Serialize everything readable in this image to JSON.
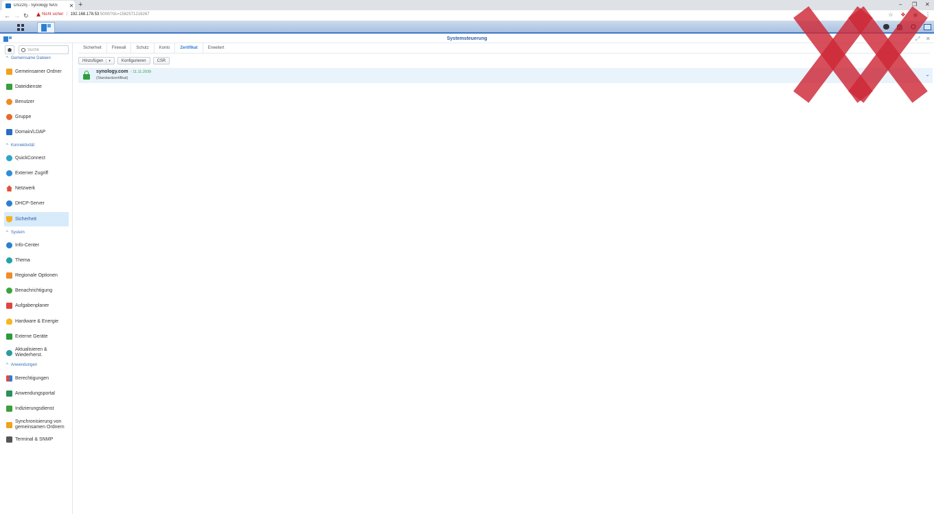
{
  "browser": {
    "tab_title": "DS220j - Synology NAS",
    "tab_close": "✕",
    "new_tab": "+",
    "security_warning": "Nicht sicher",
    "url_host": "192.168.178.53",
    "url_path": ":5000/?dc=1582571216267",
    "win_min": "–",
    "win_max": "❐",
    "win_close": "✕"
  },
  "window": {
    "title": "Systemsteuerung"
  },
  "sidebar": {
    "search_placeholder": "Suche",
    "sections": [
      {
        "label": "Gemeinsame Dateien"
      },
      {
        "label": "Konnektivität"
      },
      {
        "label": "System"
      },
      {
        "label": "Anwendungen"
      }
    ],
    "items": [
      {
        "label": "Gemeinsamer Ordner",
        "color": "#f0a21b"
      },
      {
        "label": "Dateidienste",
        "color": "#3a9e3a"
      },
      {
        "label": "Benutzer",
        "color": "#f08a24"
      },
      {
        "label": "Gruppe",
        "color": "#e56a2c"
      },
      {
        "label": "Domain/LDAP",
        "color": "#2b6cc4"
      },
      {
        "label": "QuickConnect",
        "color": "#2aa7c9"
      },
      {
        "label": "Externer Zugriff",
        "color": "#2d8fd6"
      },
      {
        "label": "Netzwerk",
        "color": "#e0503c"
      },
      {
        "label": "DHCP-Server",
        "color": "#2b7fd3"
      },
      {
        "label": "Sicherheit",
        "color": "#f2b21e"
      },
      {
        "label": "Info-Center",
        "color": "#2b7fd3"
      },
      {
        "label": "Thema",
        "color": "#21a3a8"
      },
      {
        "label": "Regionale Optionen",
        "color": "#ef8c2a"
      },
      {
        "label": "Benachrichtigung",
        "color": "#3aa53a"
      },
      {
        "label": "Aufgabenplaner",
        "color": "#e04444"
      },
      {
        "label": "Hardware & Energie",
        "color": "#f5b81f"
      },
      {
        "label": "Externe Geräte",
        "color": "#2d9b3c"
      },
      {
        "label_line1": "Aktualisieren &",
        "label_line2": "Wiederherst.",
        "color": "#2d9b9b"
      },
      {
        "label": "Berechtigungen",
        "color": "#e44a3a"
      },
      {
        "label": "Anwendungsportal",
        "color": "#2d8f5a"
      },
      {
        "label": "Indizierungsdienst",
        "color": "#3a9e3a"
      },
      {
        "label_line1": "Synchronisierung von",
        "label_line2": "gemeinsamen Ordnern",
        "color": "#f0a21b"
      },
      {
        "label": "Terminal & SNMP",
        "color": "#555555"
      }
    ]
  },
  "tabs": [
    {
      "label": "Sicherheit"
    },
    {
      "label": "Firewall"
    },
    {
      "label": "Schutz"
    },
    {
      "label": "Konto"
    },
    {
      "label": "Zertifikat",
      "active": true
    },
    {
      "label": "Erweitert"
    }
  ],
  "toolbar": {
    "add_label": "Hinzufügen",
    "add_dropdown": "▾",
    "configure_label": "Konfigurieren",
    "csr_label": "CSR"
  },
  "certificate": {
    "name": "synology.com",
    "date": "- 11.11.2039",
    "subtitle": "(Standardzertifikat)",
    "expand": "⌄"
  },
  "colors": {
    "accent": "#2a7bd4",
    "active_row": "#d8ebfa",
    "cert_row": "#e8f3fc",
    "overlay_red": "#cd2837"
  }
}
